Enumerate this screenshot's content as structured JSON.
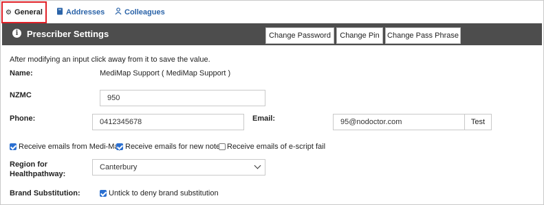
{
  "tabs": [
    {
      "label": "General",
      "icon": "gear-icon"
    },
    {
      "label": "Addresses",
      "icon": "book-icon"
    },
    {
      "label": "Colleagues",
      "icon": "users-icon"
    }
  ],
  "header": {
    "title": "Prescriber Settings",
    "buttons": {
      "change_password": "Change Password",
      "change_pin": "Change Pin",
      "change_pass_phrase": "Change Pass Phrase"
    }
  },
  "form": {
    "instructions": "After modifying an input click away from it to save the value.",
    "name_label": "Name:",
    "name_value": "MediMap Support ( MediMap Support )",
    "nzmc_label": "NZMC",
    "nzmc_value": "950",
    "phone_label": "Phone:",
    "phone_value": "0412345678",
    "email_label": "Email:",
    "email_value": "95@nodoctor.com",
    "test_button": "Test",
    "checkboxes": [
      {
        "label": "Receive emails from Medi-Map",
        "checked": true
      },
      {
        "label": "Receive emails for new notes",
        "checked": true
      },
      {
        "label": "Receive emails of e-script fail",
        "checked": false
      }
    ],
    "region_label_line1": "Region for",
    "region_label_line2": "Healthpathway:",
    "region_value": "Canterbury",
    "brand_label": "Brand Substitution:",
    "brand_checkbox": {
      "label": "Untick to deny brand substitution",
      "checked": true
    }
  },
  "colors": {
    "header_bg": "#4d4d4d",
    "tab_link": "#2a63a8",
    "active_tab_border": "#e01f26",
    "checkbox_checked": "#2a6fd1"
  }
}
